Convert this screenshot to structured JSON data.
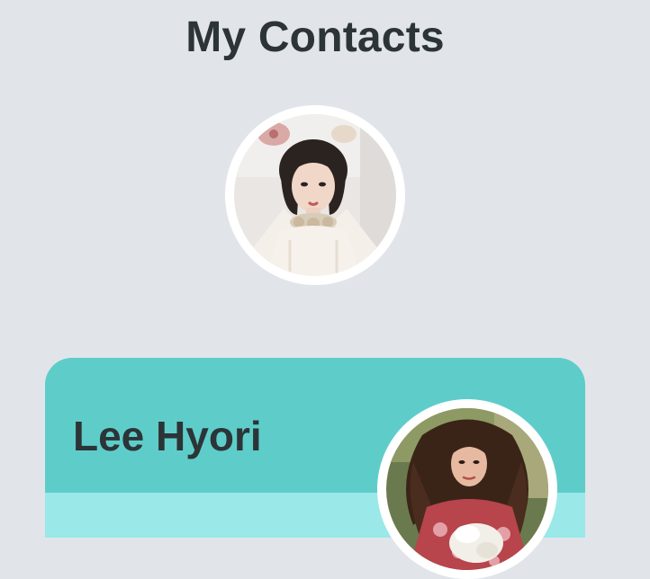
{
  "page": {
    "title": "My Contacts"
  },
  "profile": {
    "avatar_icon": "profile-photo"
  },
  "contacts": [
    {
      "name": "Lee Hyori",
      "avatar_icon": "contact-photo"
    }
  ],
  "colors": {
    "background": "#e1e5ea",
    "card_header": "#5ecdca",
    "card_body": "#9ae8e8",
    "text": "#2c3437",
    "avatar_border": "#ffffff"
  }
}
